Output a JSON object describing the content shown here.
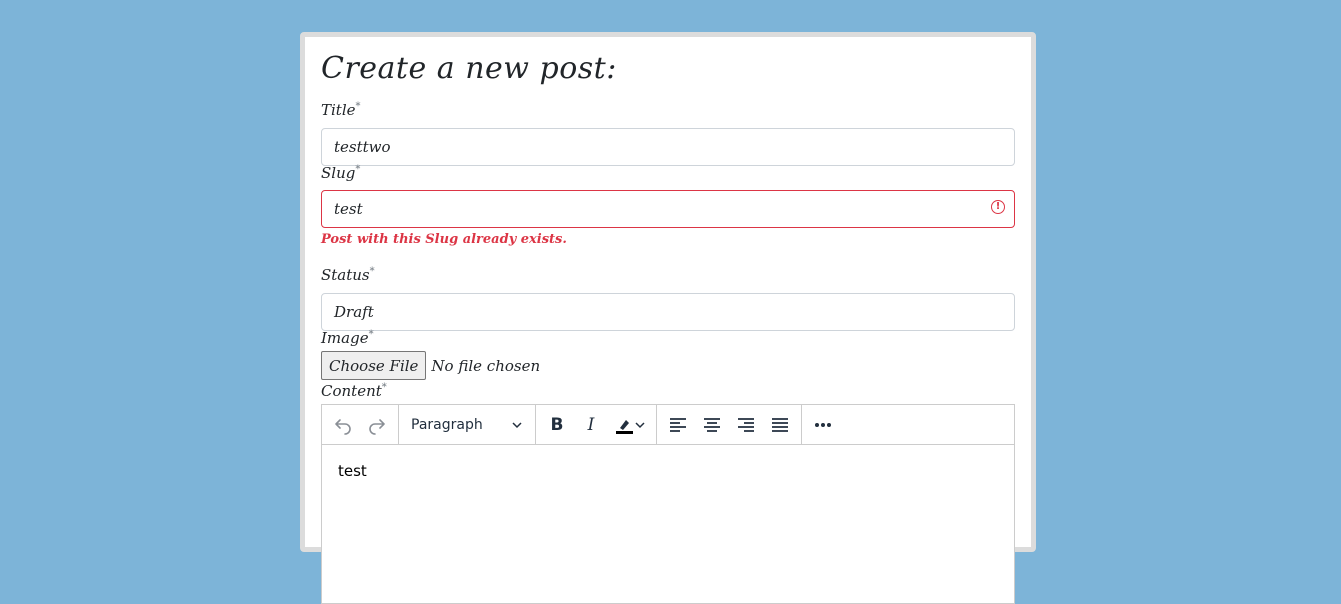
{
  "form": {
    "heading": "Create a new post:",
    "title": {
      "label": "Title",
      "required": "*",
      "value": "testtwo"
    },
    "slug": {
      "label": "Slug",
      "required": "*",
      "value": "test",
      "error": "Post with this Slug already exists."
    },
    "status": {
      "label": "Status",
      "required": "*",
      "value": "Draft"
    },
    "image": {
      "label": "Image",
      "required": "*",
      "button": "Choose File",
      "status": "No file chosen"
    },
    "content": {
      "label": "Content",
      "required": "*"
    }
  },
  "editor": {
    "block_format": "Paragraph",
    "body_text": "test",
    "icons": [
      "undo-icon",
      "redo-icon",
      "bold-icon",
      "italic-icon",
      "highlight-icon",
      "align-left-icon",
      "align-center-icon",
      "align-right-icon",
      "align-justify-icon",
      "more-icon"
    ]
  },
  "colors": {
    "background": "#7db4d8",
    "error": "#dc3545",
    "card_border": "#dcdcdc"
  }
}
